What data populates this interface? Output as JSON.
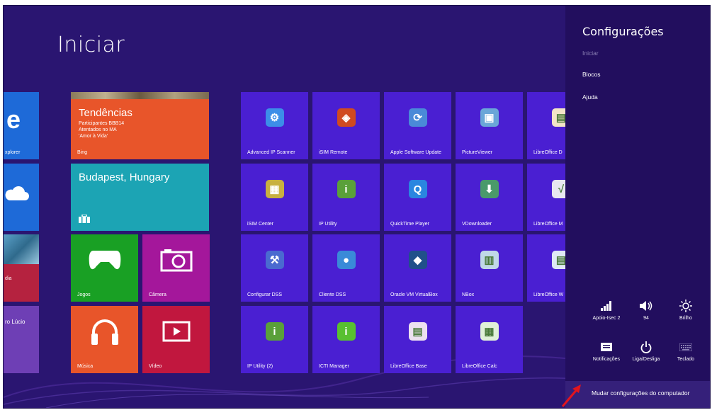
{
  "start": {
    "title": "Iniciar"
  },
  "left_tiles": [
    {
      "label": "xplorer"
    },
    {
      "label": ""
    },
    {
      "label": "dia"
    },
    {
      "label": "ro Lúcio"
    }
  ],
  "trends_tile": {
    "title": "Tendências",
    "lines": [
      "Participantes BBB14",
      "Atentados no MA",
      "'Amor à Vida'"
    ],
    "source": "Bing"
  },
  "weather_tile": {
    "title": "Budapest, Hungary"
  },
  "small_tiles": {
    "games": "Jogos",
    "camera": "Câmera",
    "music": "Música",
    "video": "Vídeo"
  },
  "app_tiles": [
    {
      "label": "Advanced IP Scanner",
      "icon": "network-scan-icon"
    },
    {
      "label": "iSIM Remote",
      "icon": "remote-icon"
    },
    {
      "label": "Apple Software Update",
      "icon": "apple-update-icon"
    },
    {
      "label": "PictureViewer",
      "icon": "picture-viewer-icon"
    },
    {
      "label": "LibreOffice D",
      "icon": "libreoffice-draw-icon"
    },
    {
      "label": "iSIM Center",
      "icon": "sim-center-icon"
    },
    {
      "label": "IP Utility",
      "icon": "ip-utility-icon"
    },
    {
      "label": "QuickTime Player",
      "icon": "quicktime-icon"
    },
    {
      "label": "VDownloader",
      "icon": "vdownloader-icon"
    },
    {
      "label": "LibreOffice M",
      "icon": "libreoffice-math-icon"
    },
    {
      "label": "Configurar DSS",
      "icon": "configure-dss-icon"
    },
    {
      "label": "Cliente DSS",
      "icon": "dss-client-icon"
    },
    {
      "label": "Oracle VM VirtualBox",
      "icon": "virtualbox-icon"
    },
    {
      "label": "NBox",
      "icon": "nbox-icon"
    },
    {
      "label": "LibreOffice W",
      "icon": "libreoffice-writer-icon"
    },
    {
      "label": "IP Utility (2)",
      "icon": "ip-utility-icon"
    },
    {
      "label": "ICTI Manager",
      "icon": "icti-manager-icon"
    },
    {
      "label": "LibreOffice Base",
      "icon": "libreoffice-base-icon"
    },
    {
      "label": "LibreOffice Calc",
      "icon": "libreoffice-calc-icon"
    }
  ],
  "charm": {
    "title": "Configurações",
    "context": "Iniciar",
    "links": [
      "Blocos",
      "Ajuda"
    ],
    "quick_settings": [
      {
        "label": "Apoio-Isec 2",
        "icon": "wifi-icon"
      },
      {
        "label": "94",
        "icon": "volume-icon"
      },
      {
        "label": "Brilho",
        "icon": "brightness-icon"
      },
      {
        "label": "Notificações",
        "icon": "notifications-icon"
      },
      {
        "label": "Liga/Desliga",
        "icon": "power-icon"
      },
      {
        "label": "Teclado",
        "icon": "keyboard-icon"
      }
    ],
    "change_settings": "Mudar configurações do computador"
  },
  "colors": {
    "background": "#2a1571",
    "charm": "#220e5e",
    "app_tile": "#4a1fd2",
    "trends": "#e8552a",
    "weather": "#1ca4b4",
    "games": "#19a024",
    "camera": "#a4179b",
    "music": "#e8552a",
    "video": "#c1173e",
    "arrow": "#e2141e"
  }
}
